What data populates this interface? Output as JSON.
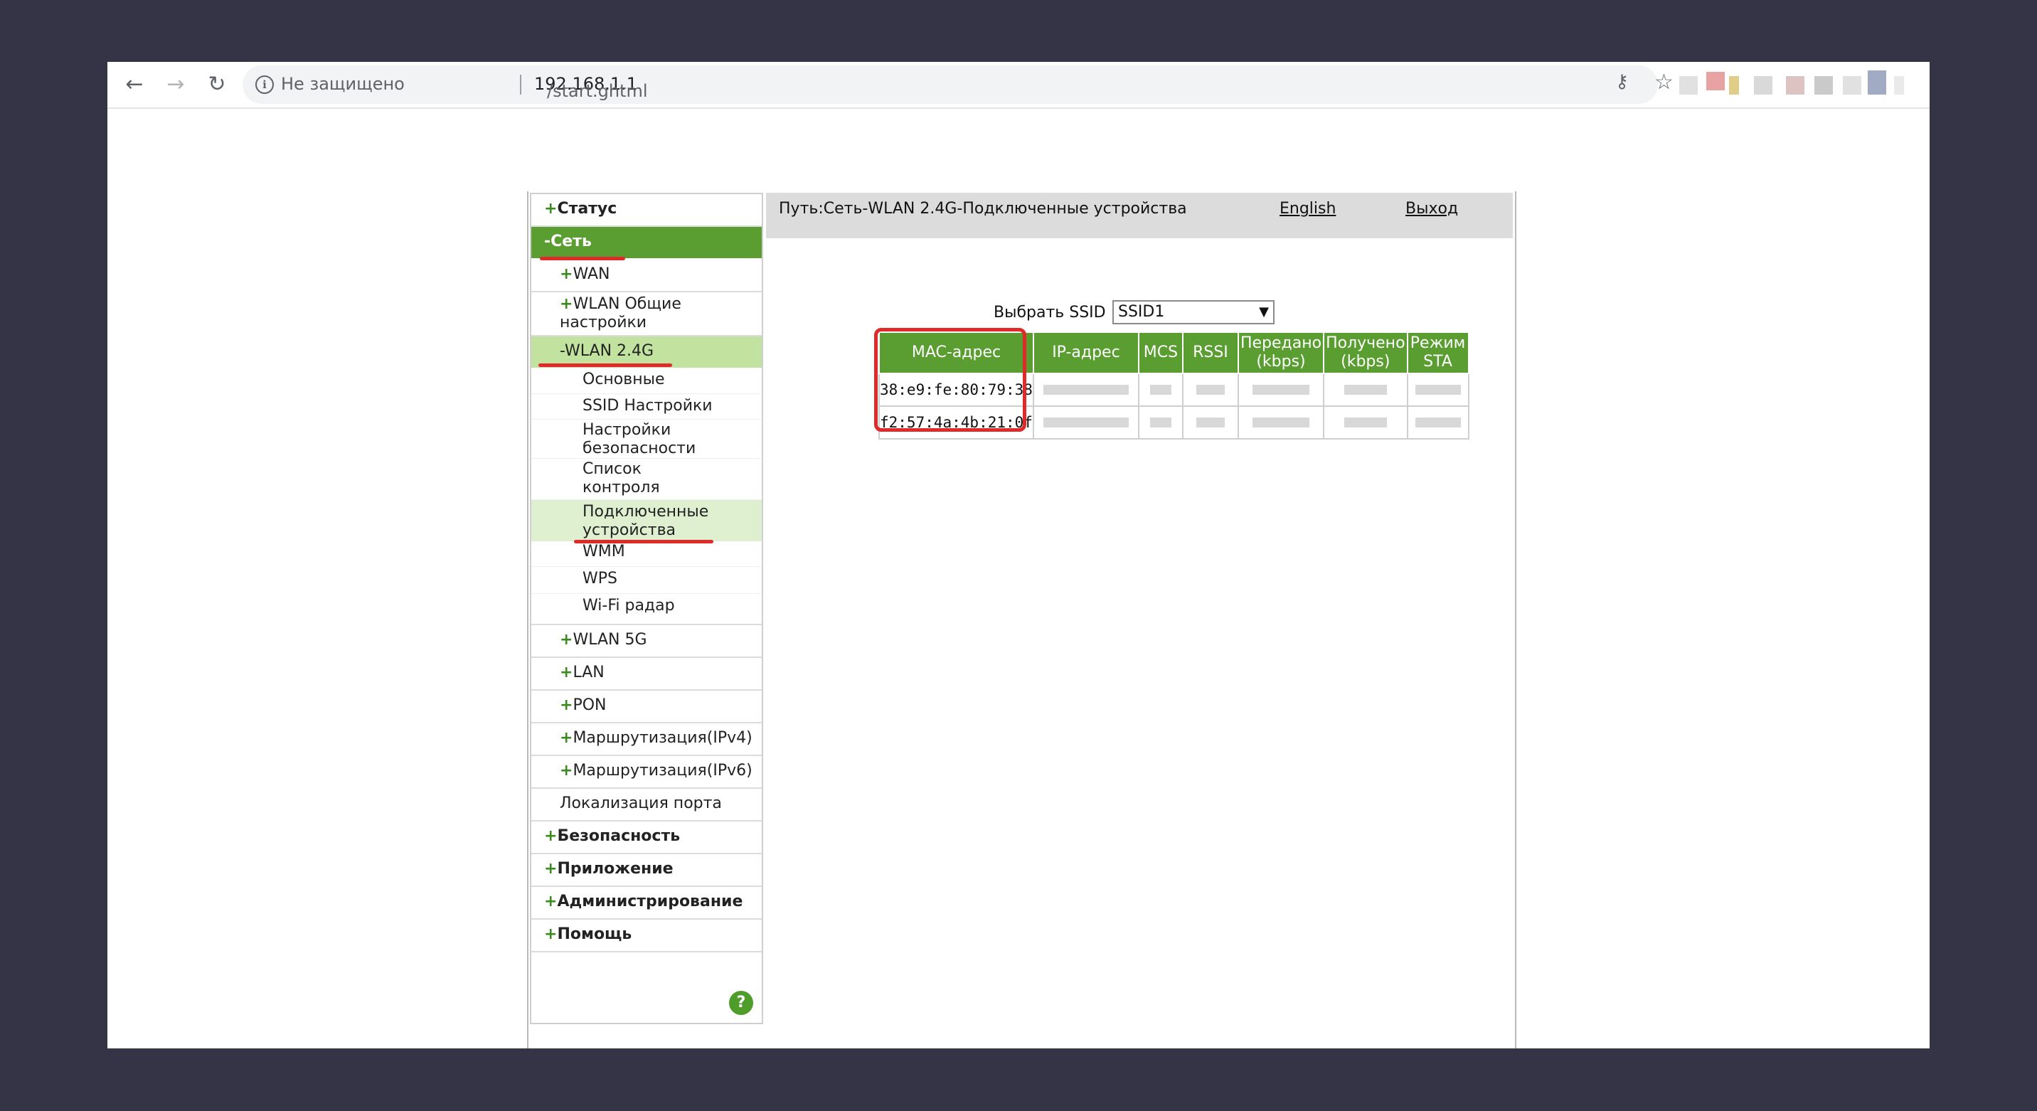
{
  "browser": {
    "security_label": "Не защищено",
    "url_host": "192.168.1.1",
    "url_path": "/start.ghtml",
    "nav": {
      "back": "←",
      "forward": "→",
      "reload": "↻"
    },
    "icons": {
      "info": "i",
      "key": "⚷",
      "star": "☆"
    }
  },
  "sidebar": {
    "items": [
      {
        "sign": "+",
        "label": "Статус"
      },
      {
        "sign": "-",
        "label": "Сеть"
      },
      {
        "sign": "+",
        "label": "WAN"
      },
      {
        "sign": "+",
        "label": "WLAN Общие настройки"
      },
      {
        "sign": "-",
        "label": "WLAN 2.4G"
      },
      {
        "sign": "",
        "label": "Основные"
      },
      {
        "sign": "",
        "label": "SSID Настройки"
      },
      {
        "sign": "",
        "label": "Настройки безопасности"
      },
      {
        "sign": "",
        "label": "Список контроля доступа"
      },
      {
        "sign": "",
        "label": "Подключенные устройства"
      },
      {
        "sign": "",
        "label": "WMM"
      },
      {
        "sign": "",
        "label": "WPS"
      },
      {
        "sign": "",
        "label": "Wi-Fi радар"
      },
      {
        "sign": "+",
        "label": "WLAN 5G"
      },
      {
        "sign": "+",
        "label": "LAN"
      },
      {
        "sign": "+",
        "label": "PON"
      },
      {
        "sign": "+",
        "label": "Маршрутизация(IPv4)"
      },
      {
        "sign": "+",
        "label": "Маршрутизация(IPv6)"
      },
      {
        "sign": "",
        "label": "Локализация порта"
      },
      {
        "sign": "+",
        "label": "Безопасность"
      },
      {
        "sign": "+",
        "label": "Приложение"
      },
      {
        "sign": "+",
        "label": "Администрирование"
      },
      {
        "sign": "+",
        "label": "Помощь"
      }
    ],
    "help_icon": "?"
  },
  "header": {
    "path": "Путь:Сеть-WLAN 2.4G-Подключенные устройства",
    "language_link": "English",
    "logout_link": "Выход"
  },
  "ssid": {
    "label": "Выбрать SSID",
    "selected": "SSID1",
    "chevron": "▼"
  },
  "devices_table": {
    "headers": [
      "MAC-адрес",
      "IP-адрес",
      "MCS",
      "RSSI",
      "Передано (kbps)",
      "Получено (kbps)",
      "Режим STA"
    ],
    "rows": [
      {
        "mac": "38:e9:fe:80:79:38"
      },
      {
        "mac": "f2:57:4a:4b:21:0f"
      }
    ]
  },
  "colors": {
    "menu_active": "#5a9e31",
    "submenu_active": "#c2e3a0",
    "table_header": "#5a9e31",
    "highlight_red": "#e02a2a",
    "page_background": "#353446"
  }
}
